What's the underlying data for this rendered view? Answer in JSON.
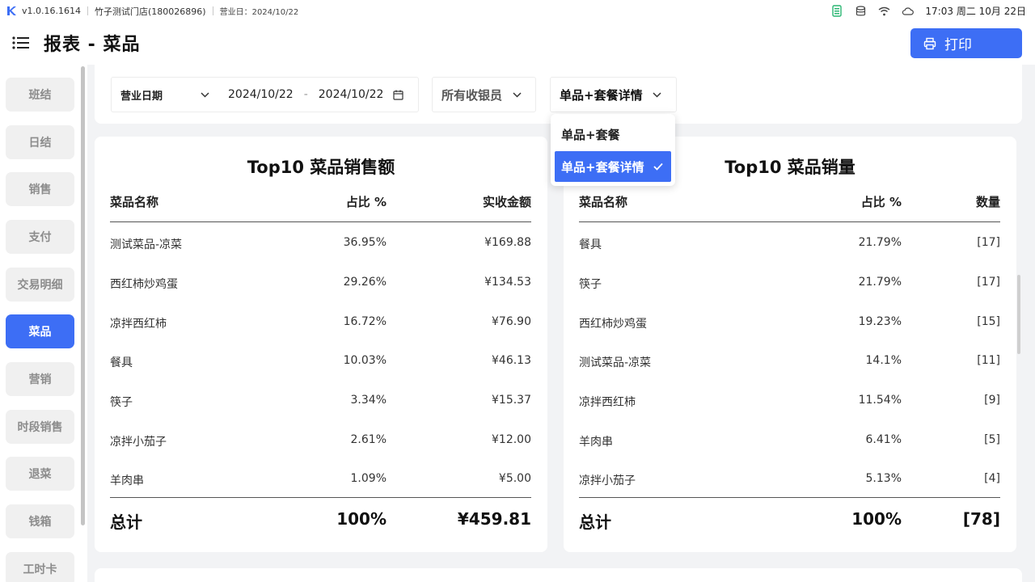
{
  "statusbar": {
    "version": "v1.0.16.1614",
    "store": "竹子测试门店(180026896)",
    "business_date": "营业日：2024/10/22",
    "datetime": "17:03 周二 10月 22日"
  },
  "header": {
    "title": "报表 - 菜品",
    "print_label": "打印"
  },
  "sidebar": {
    "items": [
      {
        "label": "班结"
      },
      {
        "label": "日结"
      },
      {
        "label": "销售"
      },
      {
        "label": "支付"
      },
      {
        "label": "交易明细"
      },
      {
        "label": "菜品",
        "active": true
      },
      {
        "label": "营销"
      },
      {
        "label": "时段销售"
      },
      {
        "label": "退菜"
      },
      {
        "label": "钱箱"
      },
      {
        "label": "工时卡"
      }
    ]
  },
  "filters": {
    "date_type": "营业日期",
    "date_start": "2024/10/22",
    "date_sep": "-",
    "date_end": "2024/10/22",
    "cashier": "所有收银员",
    "mode": "单品+套餐详情"
  },
  "dropdown": {
    "options": [
      "单品+套餐",
      "单品+套餐详情"
    ],
    "selected": "单品+套餐详情"
  },
  "sales_table": {
    "title": "Top10 菜品销售额",
    "headers": [
      "菜品名称",
      "占比 %",
      "实收金额"
    ],
    "rows": [
      [
        "测试菜品-凉菜",
        "36.95%",
        "¥169.88"
      ],
      [
        "西红柿炒鸡蛋",
        "29.26%",
        "¥134.53"
      ],
      [
        "凉拌西红柿",
        "16.72%",
        "¥76.90"
      ],
      [
        "餐具",
        "10.03%",
        "¥46.13"
      ],
      [
        "筷子",
        "3.34%",
        "¥15.37"
      ],
      [
        "凉拌小茄子",
        "2.61%",
        "¥12.00"
      ],
      [
        "羊肉串",
        "1.09%",
        "¥5.00"
      ]
    ],
    "total": [
      "总计",
      "100%",
      "¥459.81"
    ]
  },
  "qty_table": {
    "title": "Top10 菜品销量",
    "headers": [
      "菜品名称",
      "占比 %",
      "数量"
    ],
    "rows": [
      [
        "餐具",
        "21.79%",
        "[17]"
      ],
      [
        "筷子",
        "21.79%",
        "[17]"
      ],
      [
        "西红柿炒鸡蛋",
        "19.23%",
        "[15]"
      ],
      [
        "测试菜品-凉菜",
        "14.1%",
        "[11]"
      ],
      [
        "凉拌西红柿",
        "11.54%",
        "[9]"
      ],
      [
        "羊肉串",
        "6.41%",
        "[5]"
      ],
      [
        "凉拌小茄子",
        "5.13%",
        "[4]"
      ]
    ],
    "total": [
      "总计",
      "100%",
      "[78]"
    ]
  },
  "colors": {
    "accent": "#3d6ef5",
    "battery": "#2bb673"
  }
}
